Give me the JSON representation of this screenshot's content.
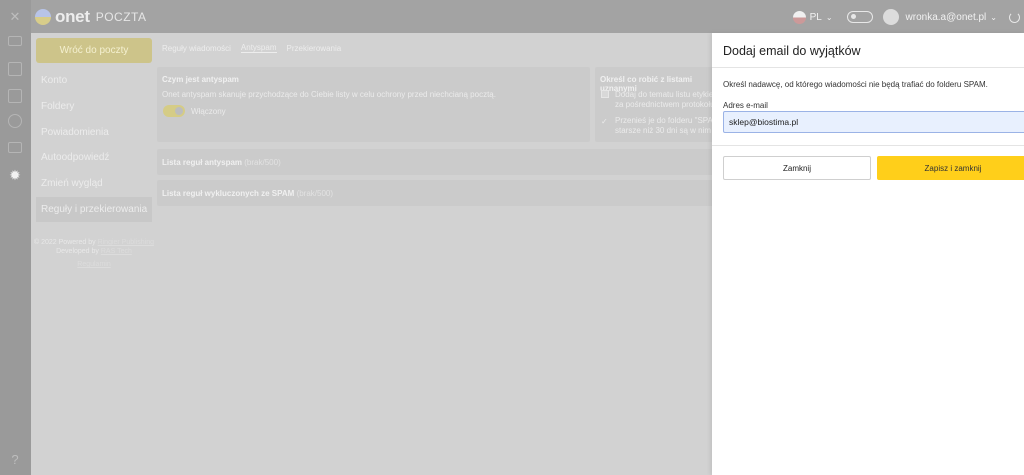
{
  "rail": {
    "icons": [
      "close-icon",
      "mail-icon",
      "calendar-icon",
      "contacts-icon",
      "tag-icon",
      "files-icon",
      "settings-icon",
      "help-icon"
    ]
  },
  "topbar": {
    "logo_text": "onet",
    "logo_product": "POCZTA",
    "language": "PL",
    "user_email": "wronka.a@onet.pl"
  },
  "sidebar": {
    "back_label": "Wróć do poczty",
    "items": [
      {
        "label": "Konto"
      },
      {
        "label": "Foldery"
      },
      {
        "label": "Powiadomienia"
      },
      {
        "label": "Autoodpowiedź"
      },
      {
        "label": "Zmień wygląd"
      },
      {
        "label": "Reguły i przekierowania"
      }
    ],
    "footer": {
      "powered_prefix": "© 2022 Powered by",
      "powered_link": "Ringier Publishing",
      "developed_prefix": "Developed by",
      "developed_link": "RAS Tech",
      "regulations": "Regulamin"
    }
  },
  "tabs": [
    "Reguły wiadomości",
    "Antyspam",
    "Przekierowania"
  ],
  "antispam": {
    "title": "Czym jest antyspam",
    "description": "Onet antyspam skanuje przychodzące do Ciebie listy w celu ochrony przed niechcianą pocztą.",
    "switch_label": "Włączony"
  },
  "spam_actions": {
    "title": "Określ co robić z listami uznanymi",
    "option1_line1": "Dodaj do tematu listu etykiet",
    "option1_line2": "za pośrednictwem protokołu",
    "option2_line1": "Przenieś je do folderu \"SPAM",
    "option2_line2": "starsze niż 30 dni są w nim a"
  },
  "rules_list": {
    "title": "Lista reguł antyspam",
    "count": "(brak/500)"
  },
  "excluded_list": {
    "title": "Lista reguł wykluczonych ze SPAM",
    "count": "(brak/500)"
  },
  "drawer": {
    "title": "Dodaj email do wyjątków",
    "description": "Określ nadawcę, od którego wiadomości nie będą trafiać do folderu SPAM.",
    "email_label": "Adres e-mail",
    "email_value": "sklep@biostima.pl",
    "close_label": "Zamknij",
    "save_label": "Zapisz i zamknij"
  },
  "colors": {
    "accent": "#ffcf1a",
    "input_bg": "#e8f0fe"
  }
}
